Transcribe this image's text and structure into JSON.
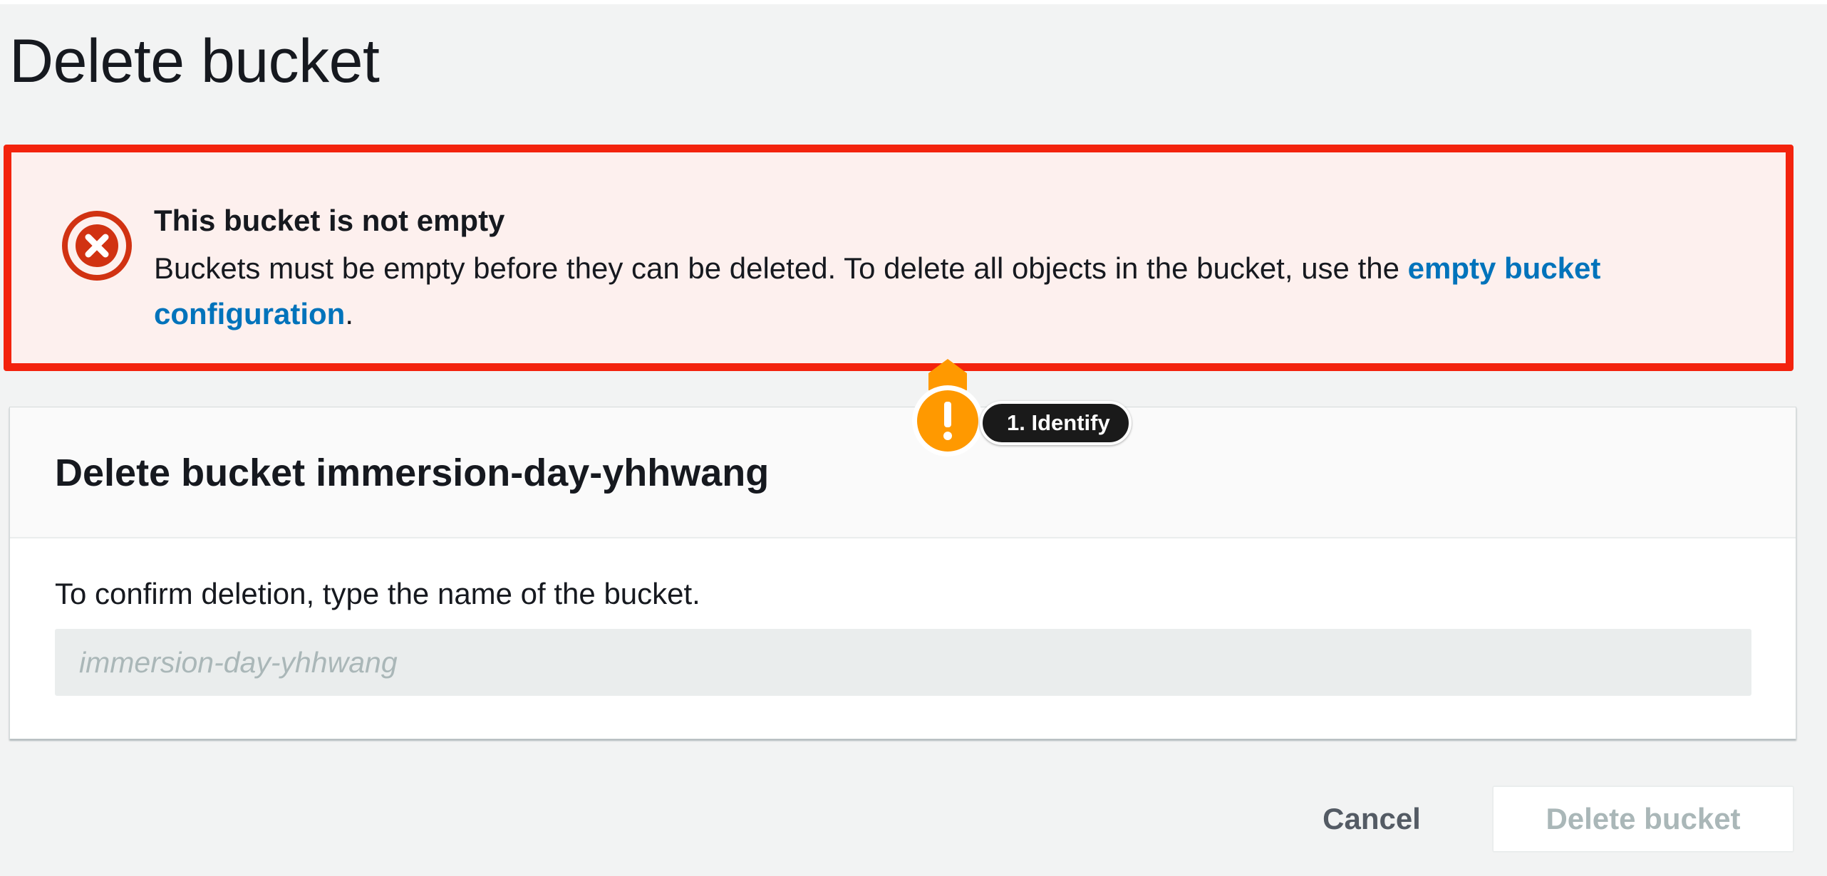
{
  "page": {
    "title": "Delete bucket"
  },
  "alert": {
    "type": "error",
    "icon": "error-circle-x-icon",
    "title": "This bucket is not empty",
    "body_prefix": "Buckets must be empty before they can be deleted. To delete all objects in the bucket, use the ",
    "link_text": "empty bucket configuration",
    "body_suffix": ".",
    "border_color": "#f3230d",
    "background_color": "#fdf0ee",
    "link_color": "#0073bb"
  },
  "callout": {
    "icon": "exclamation-icon",
    "label": "1. Identify",
    "color": "#ff9900"
  },
  "panel": {
    "title": "Delete bucket immersion-day-yhhwang",
    "confirm_label": "To confirm deletion, type the name of the bucket.",
    "input": {
      "value": "",
      "placeholder": "immersion-day-yhhwang"
    }
  },
  "actions": {
    "cancel_label": "Cancel",
    "delete_label": "Delete bucket",
    "delete_disabled": true
  }
}
